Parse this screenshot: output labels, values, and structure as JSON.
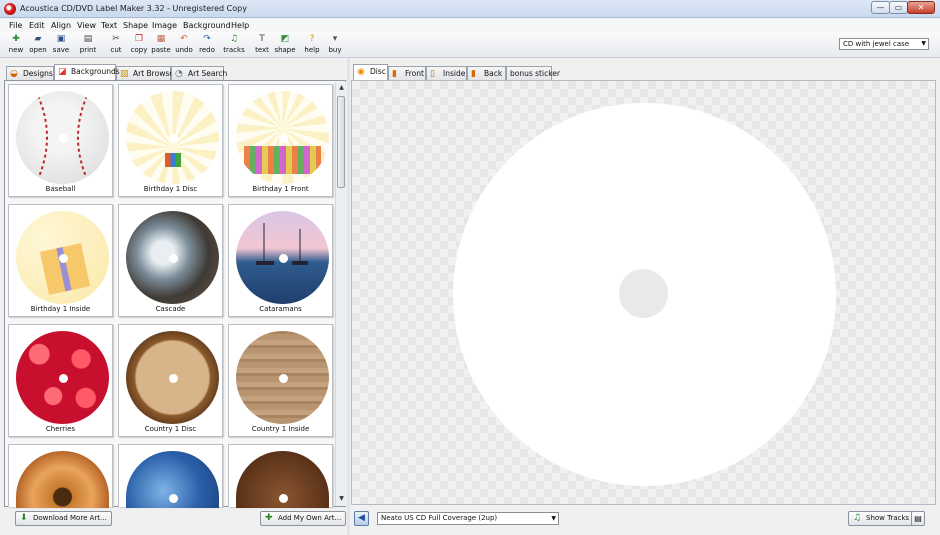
{
  "window": {
    "title": "Acoustica CD/DVD Label Maker 3.32 - Unregistered Copy",
    "buttons": {
      "minimize": "—",
      "maximize": "▭",
      "close": "✕"
    }
  },
  "menu": [
    "File",
    "Edit",
    "Align",
    "View",
    "Text",
    "Shape",
    "Image",
    "Background",
    "Help"
  ],
  "toolbar": {
    "tools": [
      {
        "label": "new",
        "icon": "new-icon"
      },
      {
        "label": "open",
        "icon": "open-icon"
      },
      {
        "label": "save",
        "icon": "save-icon"
      },
      {
        "label": "print",
        "icon": "print-icon"
      },
      {
        "label": "cut",
        "icon": "cut-icon"
      },
      {
        "label": "copy",
        "icon": "copy-icon"
      },
      {
        "label": "paste",
        "icon": "paste-icon"
      },
      {
        "label": "undo",
        "icon": "undo-icon"
      },
      {
        "label": "redo",
        "icon": "redo-icon"
      },
      {
        "label": "tracks",
        "icon": "tracks-icon"
      },
      {
        "label": "text",
        "icon": "text-icon"
      },
      {
        "label": "shape",
        "icon": "shape-icon"
      },
      {
        "label": "help",
        "icon": "help-icon"
      },
      {
        "label": "buy",
        "icon": "buy-icon"
      }
    ],
    "case_select": "CD with jewel case"
  },
  "left_tabs": [
    "Designs",
    "Backgrounds",
    "Art Browse",
    "Art Search"
  ],
  "left_active_tab": "Backgrounds",
  "backgrounds": [
    {
      "label": "Baseball"
    },
    {
      "label": "Birthday 1 Disc"
    },
    {
      "label": "Birthday 1 Front"
    },
    {
      "label": "Birthday 1 Inside"
    },
    {
      "label": "Cascade"
    },
    {
      "label": "Cataramans"
    },
    {
      "label": "Cherries"
    },
    {
      "label": "Country 1 Disc"
    },
    {
      "label": "Country 1 Inside"
    },
    {
      "label": ""
    },
    {
      "label": ""
    },
    {
      "label": ""
    }
  ],
  "left_buttons": {
    "download": "Download More Art...",
    "add_own": "Add My Own Art..."
  },
  "right_tabs": [
    "Disc",
    "Front",
    "Inside",
    "Back",
    "bonus sticker"
  ],
  "right_active_tab": "Disc",
  "paper_select": "Neato US CD Full Coverage (2up)",
  "show_tracks": "Show Tracks",
  "colors": {
    "accent_tab": "#f08c00",
    "window_close": "#c7402b",
    "canvas_bg": "#f1f1f1"
  }
}
